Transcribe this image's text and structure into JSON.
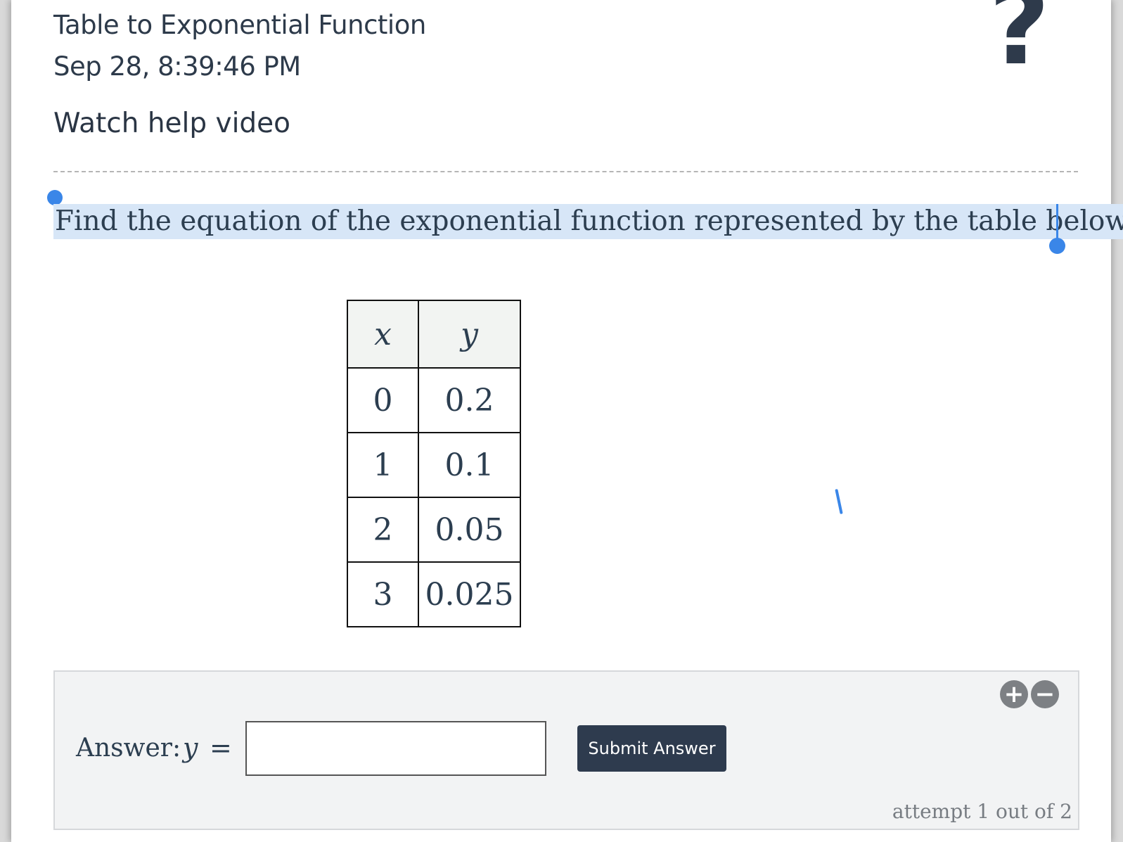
{
  "header": {
    "topic": "Table to Exponential Function",
    "timestamp": "Sep 28, 8:39:46 PM",
    "help_video_link": "Watch help video",
    "help_icon": "question-mark-icon",
    "help_glyph": "?"
  },
  "question": {
    "prompt": "Find the equation of the exponential function represented by the table below:",
    "table": {
      "headers": [
        "x",
        "y"
      ],
      "rows": [
        [
          "0",
          "0.2"
        ],
        [
          "1",
          "0.1"
        ],
        [
          "2",
          "0.05"
        ],
        [
          "3",
          "0.025"
        ]
      ]
    }
  },
  "answer": {
    "label": "Answer:",
    "variable": "y",
    "equals": "=",
    "input_value": "",
    "submit_label": "Submit Answer",
    "attempt_text": "attempt 1 out of 2",
    "zoom_in_icon": "plus-circle-icon",
    "zoom_in_glyph": "+",
    "zoom_out_icon": "minus-circle-icon",
    "zoom_out_glyph": "−"
  },
  "colors": {
    "accent": "#3a86e8",
    "button": "#2e3b4e",
    "selection": "#d7e6f7"
  }
}
